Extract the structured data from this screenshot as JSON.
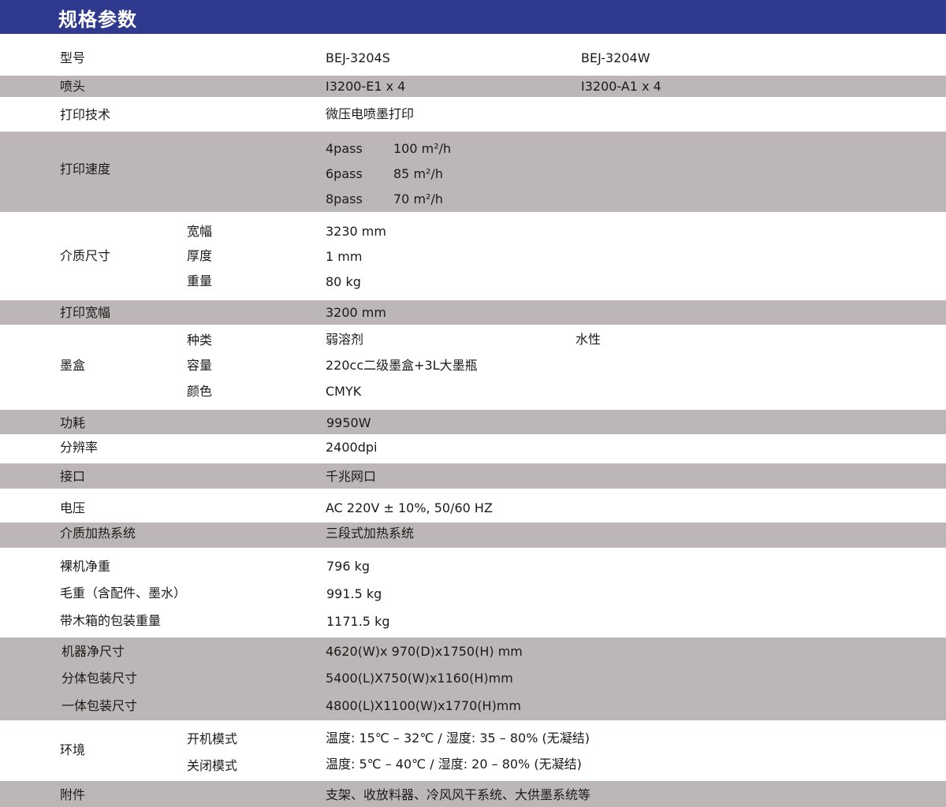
{
  "header": {
    "title": "规格参数"
  },
  "spec": {
    "model": {
      "label": "型号",
      "s": "BEJ-3204S",
      "w": "BEJ-3204W"
    },
    "nozzle": {
      "label": "喷头",
      "s": "I3200-E1 x 4",
      "w": "I3200-A1 x 4"
    },
    "tech": {
      "label": "打印技术",
      "value": "微压电喷墨打印"
    },
    "speed": {
      "label": "打印速度",
      "rows": [
        {
          "pass": "4pass",
          "value": "100  m²/h"
        },
        {
          "pass": "6pass",
          "value": "85  m²/h"
        },
        {
          "pass": "8pass",
          "value": "70  m²/h"
        }
      ]
    },
    "media": {
      "label": "介质尺寸",
      "rows": [
        {
          "label": "宽幅",
          "value": "3230 mm"
        },
        {
          "label": "厚度",
          "value": "1 mm"
        },
        {
          "label": "重量",
          "value": "80 kg"
        }
      ]
    },
    "print_width": {
      "label": "打印宽幅",
      "value": "3200 mm"
    },
    "ink": {
      "label": "墨盒",
      "type_label": "种类",
      "type_s": "弱溶剂",
      "type_w": "水性",
      "cap_label": "容量",
      "cap_value": "220cc二级墨盒+3L大墨瓶",
      "color_label": "颜色",
      "color_value": "CMYK"
    },
    "power": {
      "label": "功耗",
      "value": "9950W"
    },
    "resolution": {
      "label": "分辨率",
      "value": "2400dpi"
    },
    "interface": {
      "label": "接口",
      "value": "千兆网口"
    },
    "voltage": {
      "label": "电压",
      "value": "AC 220V  ±  10%, 50/60 HZ"
    },
    "heating": {
      "label": "介质加热系统",
      "value": "三段式加热系统"
    },
    "weights": [
      {
        "label": "裸机净重",
        "value": "796 kg"
      },
      {
        "label": "毛重（含配件、墨水）",
        "value": "991.5 kg"
      },
      {
        "label": "带木箱的包装重量",
        "value": "1171.5 kg"
      }
    ],
    "dimensions": [
      {
        "label": "机器净尺寸",
        "value": "4620(W)x 970(D)x1750(H) mm"
      },
      {
        "label": "分体包装尺寸",
        "value": "5400(L)X750(W)x1160(H)mm"
      },
      {
        "label": "一体包装尺寸",
        "value": "4800(L)X1100(W)x1770(H)mm"
      }
    ],
    "env": {
      "label": "环境",
      "on_label": "开机模式",
      "on_value": "温度: 15℃ – 32℃ / 湿度: 35 – 80% (无凝结)",
      "off_label": "关闭模式",
      "off_value": "温度: 5℃ – 40℃ / 湿度: 20 – 80% (无凝结)"
    },
    "accessories": {
      "label": "附件",
      "value": "支架、收放料器、冷风风干系统、大供墨系统等"
    }
  }
}
